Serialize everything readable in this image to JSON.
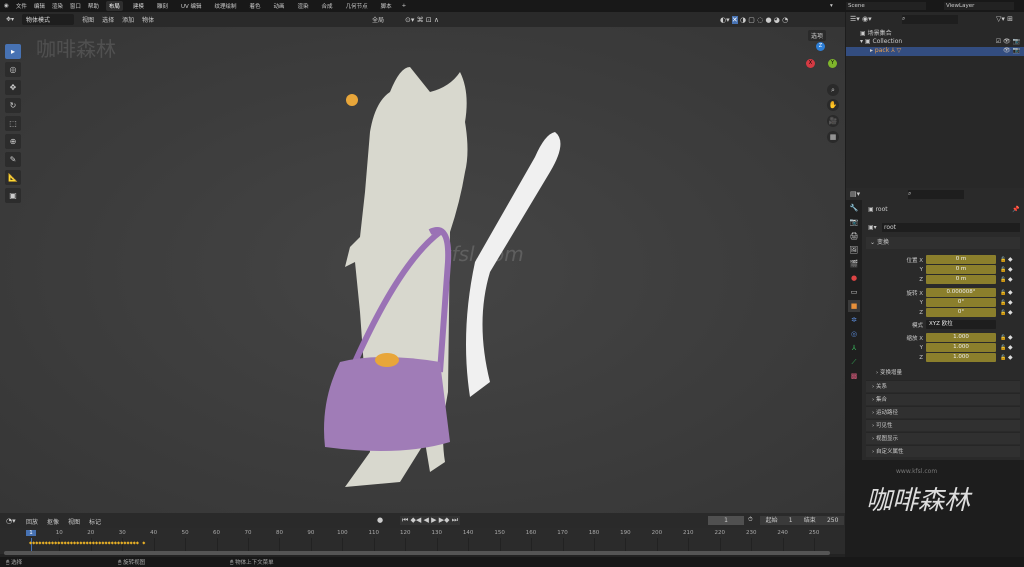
{
  "menu": {
    "items": [
      "文件",
      "编辑",
      "渲染",
      "窗口",
      "帮助"
    ],
    "workspaces": [
      "布局",
      "建模",
      "雕刻",
      "UV 编辑",
      "纹理绘制",
      "着色",
      "动画",
      "渲染",
      "合成",
      "几何节点",
      "脚本"
    ],
    "active_workspace": "布局",
    "scene": "Scene",
    "view_layer": "ViewLayer"
  },
  "header": {
    "mode": "物体模式",
    "menus": [
      "视图",
      "选择",
      "添加",
      "物体"
    ],
    "orientation": "全局",
    "options": "选项"
  },
  "viewport": {
    "watermark_top": "咖啡森林",
    "watermark_center": "kfsl.com",
    "gizmo": {
      "z": "Z",
      "y": "Y",
      "x": "X"
    }
  },
  "outliner": {
    "scene_collection": "场景集合",
    "collection": "Collection",
    "object": "pack"
  },
  "properties": {
    "object_name": "root",
    "data_name": "root",
    "section": "变换",
    "location": {
      "label": "位置",
      "values": [
        "0 m",
        "0 m",
        "0 m"
      ]
    },
    "rotation": {
      "label": "旋转",
      "values": [
        "0.000008°",
        "0°",
        "0°"
      ]
    },
    "mode": {
      "label": "模式",
      "value": "XYZ 欧拉"
    },
    "scale": {
      "label": "缩放",
      "values": [
        "1.000",
        "1.000",
        "1.000"
      ]
    },
    "axes": [
      "X",
      "Y",
      "Z"
    ],
    "delta": "变换增量",
    "panels": [
      "关系",
      "集合",
      "运动路径",
      "可见性",
      "视图显示",
      "自定义属性"
    ]
  },
  "logo": {
    "url": "www.kfsl.com",
    "text": "咖啡森林"
  },
  "timeline": {
    "menus": [
      "回放",
      "抠像",
      "视图",
      "标记"
    ],
    "current_frame": "1",
    "start_label": "起始",
    "start": "1",
    "end_label": "结束",
    "end": "250",
    "ticks": [
      "1",
      "10",
      "20",
      "30",
      "40",
      "50",
      "60",
      "70",
      "80",
      "90",
      "100",
      "110",
      "120",
      "130",
      "140",
      "150",
      "160",
      "170",
      "180",
      "190",
      "200",
      "210",
      "220",
      "230",
      "240",
      "250"
    ]
  },
  "status": {
    "items": [
      "选择",
      "旋转视图",
      "物体上下文菜单"
    ]
  },
  "colors": {
    "accent": "#4772b3",
    "field": "#8b7f2c",
    "keyframe": "#e8b026",
    "bag": "#a07cb7",
    "cat": "#d8d8ce"
  }
}
